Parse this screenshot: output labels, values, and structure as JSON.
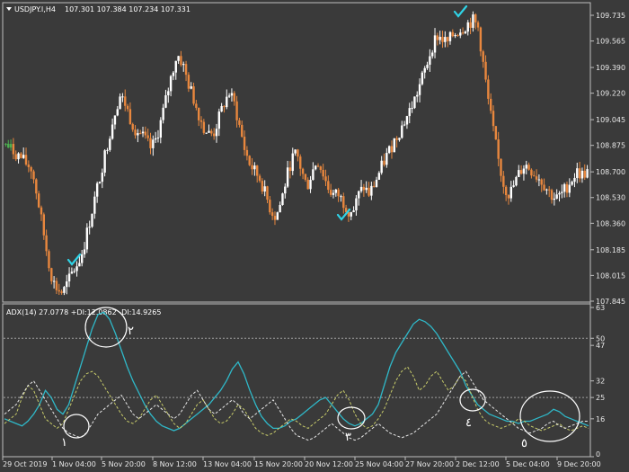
{
  "main_panel": {
    "symbol_label": "USDJPY.I,H4",
    "ohlc": "107.301 107.384 107.234 107.331",
    "price_axis": [
      "109.735",
      "109.565",
      "109.390",
      "109.220",
      "109.045",
      "108.875",
      "108.700",
      "108.530",
      "108.360",
      "108.185",
      "108.015",
      "107.845"
    ]
  },
  "indicator_panel": {
    "label": "ADX(14) 27.0778 +DI:12.0862 -DI:14.9265",
    "axis_labels": [
      "63",
      "50",
      "47",
      "32",
      "25",
      "16",
      "0"
    ]
  },
  "time_axis": [
    "29 Oct 2019",
    "1 Nov 04:00",
    "5 Nov 20:00",
    "8 Nov 12:00",
    "13 Nov 04:00",
    "15 Nov 20:00",
    "20 Nov 12:00",
    "25 Nov 04:00",
    "27 Nov 20:00",
    "2 Dec 12:00",
    "5 Dec 04:00",
    "9 Dec 20:00"
  ],
  "annotations": {
    "circle_numbers": [
      "١",
      "٢",
      "٣",
      "٤",
      "٥"
    ]
  },
  "colors": {
    "background": "#3a3a3a",
    "bull_candle": "#ffffff",
    "bear_candle": "#e8873e",
    "check_mark": "#2fd3e6",
    "adx_line": "#2fb8c8",
    "plus_di_line": "#c8cc6a",
    "minus_di_line": "#e8e8e8",
    "level_line": "#a0a0a0"
  },
  "chart_data": [
    {
      "type": "candlestick",
      "title": "USDJPY.I,H4",
      "ylim": [
        107.845,
        109.8
      ],
      "close_path": [
        108.88,
        108.85,
        108.82,
        108.79,
        108.75,
        108.72,
        108.55,
        108.35,
        108.15,
        107.98,
        107.92,
        107.9,
        107.97,
        108.05,
        108.1,
        108.2,
        108.35,
        108.5,
        108.65,
        108.8,
        108.95,
        109.1,
        109.2,
        109.15,
        109.05,
        108.98,
        108.95,
        108.9,
        108.85,
        108.92,
        109.05,
        109.2,
        109.35,
        109.48,
        109.42,
        109.3,
        109.2,
        109.1,
        109.0,
        108.95,
        108.95,
        109.05,
        109.15,
        109.22,
        109.15,
        109.0,
        108.85,
        108.75,
        108.7,
        108.65,
        108.55,
        108.45,
        108.4,
        108.5,
        108.65,
        108.78,
        108.82,
        108.7,
        108.6,
        108.7,
        108.78,
        108.7,
        108.6,
        108.55,
        108.55,
        108.5,
        108.45,
        108.45,
        108.55,
        108.6,
        108.55,
        108.62,
        108.7,
        108.78,
        108.85,
        108.92,
        108.98,
        109.05,
        109.12,
        109.2,
        109.3,
        109.4,
        109.52,
        109.6,
        109.58,
        109.55,
        109.6,
        109.63,
        109.65,
        109.68,
        109.7,
        109.65,
        109.4,
        109.15,
        108.95,
        108.75,
        108.6,
        108.55,
        108.62,
        108.7,
        108.75,
        108.72,
        108.68,
        108.65,
        108.6,
        108.55,
        108.52,
        108.55,
        108.6,
        108.65,
        108.7,
        108.68,
        108.7
      ],
      "x_tick_labels": [
        "29 Oct 2019",
        "1 Nov 04:00",
        "5 Nov 20:00",
        "8 Nov 12:00",
        "13 Nov 04:00",
        "15 Nov 20:00",
        "20 Nov 12:00",
        "25 Nov 04:00",
        "27 Nov 20:00",
        "2 Dec 12:00",
        "5 Dec 04:00",
        "9 Dec 20:00"
      ]
    },
    {
      "type": "line",
      "title": "ADX(14) 27.0778 +DI:12.0862 -DI:14.9265",
      "ylim": [
        0,
        63
      ],
      "levels": [
        50,
        25
      ],
      "series": [
        {
          "name": "ADX(14)",
          "values": [
            16,
            15,
            14,
            13,
            15,
            18,
            22,
            28,
            25,
            20,
            18,
            22,
            30,
            38,
            46,
            54,
            60,
            61,
            58,
            52,
            45,
            38,
            32,
            27,
            22,
            18,
            15,
            13,
            12,
            11,
            12,
            14,
            16,
            18,
            20,
            22,
            25,
            28,
            32,
            37,
            40,
            35,
            28,
            22,
            17,
            14,
            12,
            12,
            13,
            15,
            16,
            18,
            20,
            22,
            24,
            25,
            22,
            19,
            16,
            14,
            13,
            14,
            16,
            18,
            22,
            30,
            38,
            44,
            48,
            52,
            56,
            58,
            57,
            55,
            52,
            48,
            44,
            40,
            36,
            30,
            26,
            22,
            20,
            18,
            17,
            16,
            15,
            15,
            14,
            15,
            15,
            16,
            17,
            18,
            20,
            19,
            17,
            16,
            15,
            14,
            13
          ]
        },
        {
          "name": "+DI",
          "values": [
            14,
            16,
            18,
            25,
            30,
            28,
            22,
            16,
            14,
            12,
            14,
            20,
            26,
            32,
            35,
            36,
            34,
            30,
            26,
            22,
            18,
            15,
            14,
            16,
            20,
            24,
            26,
            22,
            18,
            14,
            12,
            14,
            18,
            22,
            24,
            20,
            16,
            14,
            15,
            18,
            22,
            20,
            16,
            12,
            10,
            9,
            10,
            12,
            14,
            16,
            15,
            13,
            12,
            14,
            16,
            18,
            22,
            26,
            28,
            24,
            18,
            14,
            12,
            13,
            16,
            20,
            26,
            32,
            36,
            38,
            34,
            28,
            30,
            34,
            36,
            32,
            28,
            30,
            34,
            32,
            26,
            20,
            16,
            14,
            13,
            12,
            13,
            14,
            16,
            15,
            13,
            12,
            11,
            12,
            13,
            14,
            12,
            11,
            12,
            13,
            12
          ]
        },
        {
          "name": "-DI",
          "values": [
            18,
            20,
            22,
            26,
            30,
            32,
            28,
            24,
            20,
            16,
            12,
            10,
            9,
            8,
            10,
            14,
            18,
            20,
            22,
            24,
            26,
            22,
            18,
            16,
            18,
            20,
            22,
            20,
            18,
            16,
            18,
            22,
            26,
            28,
            24,
            20,
            18,
            20,
            22,
            24,
            22,
            18,
            16,
            18,
            20,
            22,
            24,
            20,
            16,
            12,
            9,
            8,
            7,
            8,
            10,
            12,
            14,
            12,
            10,
            8,
            7,
            8,
            10,
            12,
            14,
            12,
            10,
            9,
            8,
            9,
            10,
            12,
            14,
            16,
            18,
            22,
            26,
            30,
            34,
            36,
            32,
            28,
            24,
            22,
            20,
            18,
            16,
            14,
            12,
            11,
            10,
            11,
            12,
            14,
            15,
            13,
            12,
            13,
            14,
            15,
            15
          ]
        }
      ],
      "annotations": [
        "١",
        "٢",
        "٣",
        "٤",
        "٥"
      ]
    }
  ]
}
